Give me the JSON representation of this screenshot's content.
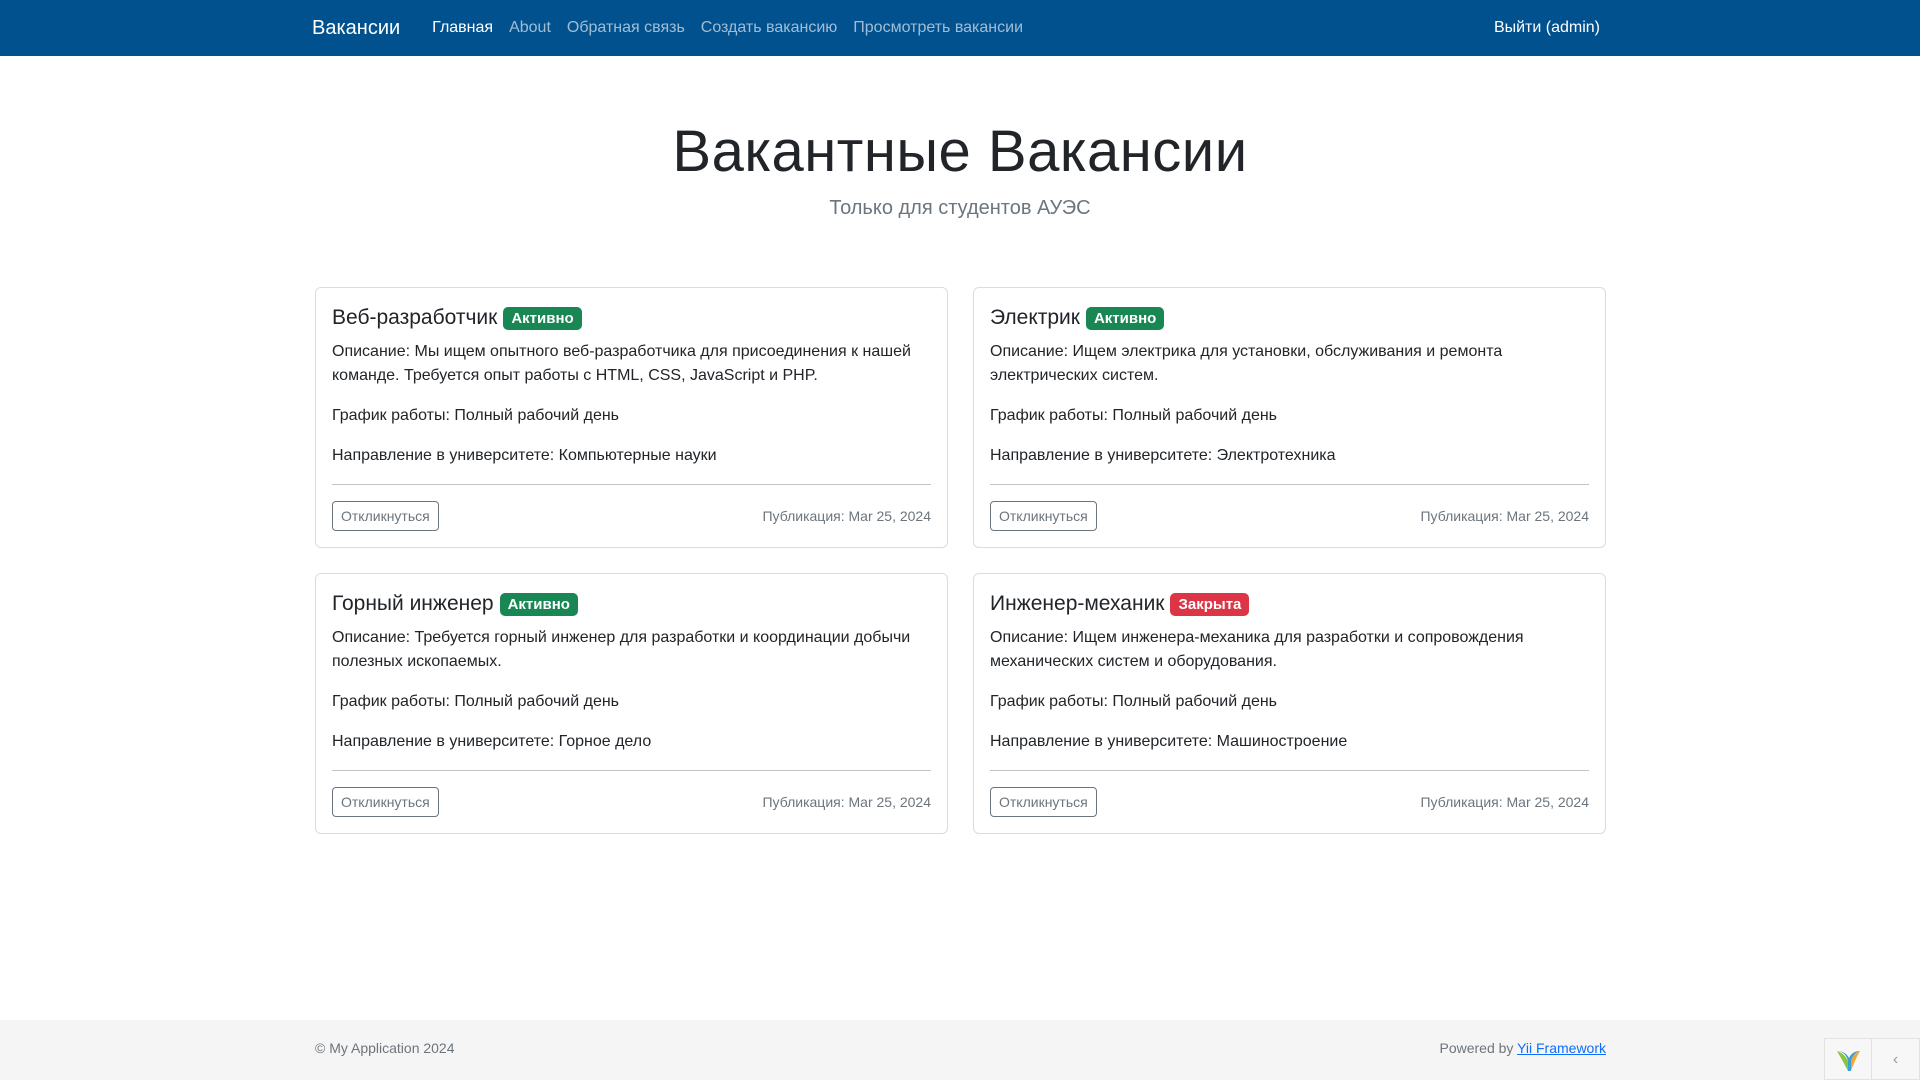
{
  "navbar": {
    "brand": "Вакансии",
    "links": [
      "Главная",
      "About",
      "Обратная связь",
      "Создать вакансию",
      "Просмотреть вакансии"
    ],
    "logout": "Выйти (admin)",
    "bg_color": "#02518f"
  },
  "hero": {
    "title": "Вакантные Вакансии",
    "subtitle": "Только для студентов АУЭС"
  },
  "jobs": [
    {
      "title": "Веб-разработчик",
      "status": "Активно",
      "status_color": "#198754",
      "description": "Описание: Мы ищем опытного веб-разработчика для присоединения к нашей команде. Требуется опыт работы с HTML, CSS, JavaScript и PHP.",
      "schedule": "График работы: Полный рабочий день",
      "direction": "Направление в университете: Компьютерные науки",
      "apply": "Откликнуться",
      "published": "Публикация: Mar 25, 2024"
    },
    {
      "title": "Электрик",
      "status": "Активно",
      "status_color": "#198754",
      "description": "Описание: Ищем электрика для установки, обслуживания и ремонта электрических систем.",
      "schedule": "График работы: Полный рабочий день",
      "direction": "Направление в университете: Электротехника",
      "apply": "Откликнуться",
      "published": "Публикация: Mar 25, 2024"
    },
    {
      "title": "Горный инженер",
      "status": "Активно",
      "status_color": "#198754",
      "description": "Описание: Требуется горный инженер для разработки и координации добычи полезных ископаемых.",
      "schedule": "График работы: Полный рабочий день",
      "direction": "Направление в университете: Горное дело",
      "apply": "Откликнуться",
      "published": "Публикация: Mar 25, 2024"
    },
    {
      "title": "Инженер-механик",
      "status": "Закрыта",
      "status_color": "#dc3545",
      "description": "Описание: Ищем инженера-механика для разработки и сопровождения механических систем и оборудования.",
      "schedule": "График работы: Полный рабочий день",
      "direction": "Направление в университете: Машиностроение",
      "apply": "Откликнуться",
      "published": "Публикация: Mar 25, 2024"
    }
  ],
  "footer": {
    "copyright": "© My Application 2024",
    "powered_prefix": "Powered by ",
    "powered_link": "Yii Framework"
  },
  "debug_toolbar": {
    "logo_icon": "yii-logo-icon",
    "toggle_icon": "chevron-left-icon"
  }
}
